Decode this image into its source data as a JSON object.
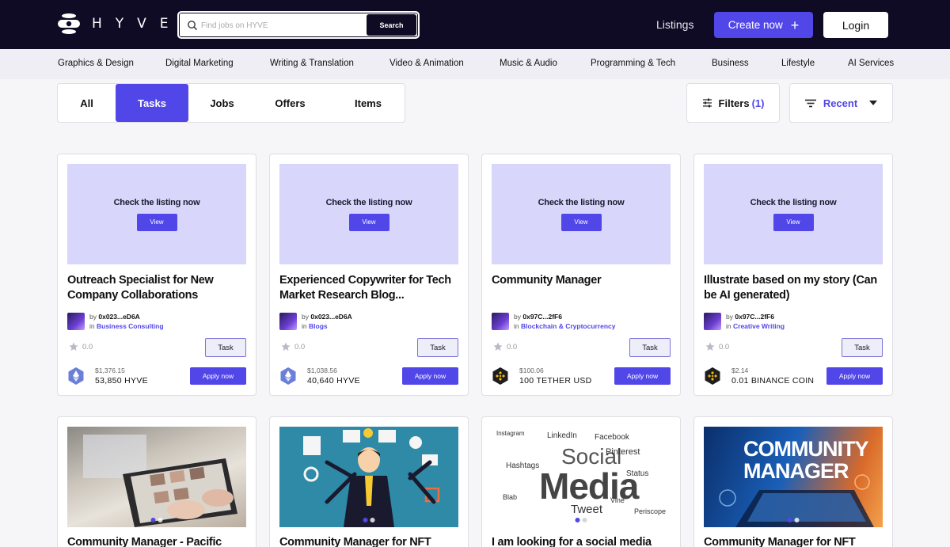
{
  "brand": {
    "name": "HYVE"
  },
  "search": {
    "placeholder": "Find jobs on HYVE",
    "button_label": "Search"
  },
  "nav": {
    "listings": "Listings",
    "create_label": "Create now",
    "create_icon": "plus-icon",
    "login": "Login"
  },
  "categories": [
    "Graphics & Design",
    "Digital Marketing",
    "Writing & Translation",
    "Video & Animation",
    "Music & Audio",
    "Programming & Tech",
    "Business",
    "Lifestyle",
    "AI Services"
  ],
  "tabs": [
    {
      "label": "All",
      "active": false
    },
    {
      "label": "Tasks",
      "active": true
    },
    {
      "label": "Jobs",
      "active": false
    },
    {
      "label": "Offers",
      "active": false
    },
    {
      "label": "Items",
      "active": false
    }
  ],
  "filters": {
    "label": "Filters",
    "count": "(1)"
  },
  "sort": {
    "label": "Recent"
  },
  "colors": {
    "accent": "#5146e8",
    "header_bg": "#0f0b24",
    "thumb_bg": "#d8d6fb"
  },
  "cards": [
    {
      "thumb_title": "Check the listing now",
      "view_label": "View",
      "title": "Outreach Specialist for New Company Collaborations",
      "by_prefix": "by",
      "author": "0x023...eD6A",
      "in_prefix": "in",
      "category": "Business Consulting",
      "rating": "0.0",
      "type": "Task",
      "price_usd": "$1,376.15",
      "price_amount": "53,850 HYVE",
      "coin_icon": "ethereum-icon",
      "apply_label": "Apply now"
    },
    {
      "thumb_title": "Check the listing now",
      "view_label": "View",
      "title": "Experienced Copywriter for Tech Market Research Blog...",
      "by_prefix": "by",
      "author": "0x023...eD6A",
      "in_prefix": "in",
      "category": "Blogs",
      "rating": "0.0",
      "type": "Task",
      "price_usd": "$1,038.56",
      "price_amount": "40,640 HYVE",
      "coin_icon": "ethereum-icon",
      "apply_label": "Apply now"
    },
    {
      "thumb_title": "Check the listing now",
      "view_label": "View",
      "title": "Community Manager",
      "by_prefix": "by",
      "author": "0x97C...2fF6",
      "in_prefix": "in",
      "category": "Blockchain & Cryptocurrency",
      "rating": "0.0",
      "type": "Task",
      "price_usd": "$100.06",
      "price_amount": "100 TETHER USD",
      "coin_icon": "binance-icon",
      "apply_label": "Apply now"
    },
    {
      "thumb_title": "Check the listing now",
      "view_label": "View",
      "title": "Illustrate based on my story (Can be AI generated)",
      "by_prefix": "by",
      "author": "0x97C...2fF6",
      "in_prefix": "in",
      "category": "Creative Writing",
      "rating": "0.0",
      "type": "Task",
      "price_usd": "$2.14",
      "price_amount": "0.01 BINANCE COIN",
      "coin_icon": "binance-icon",
      "apply_label": "Apply now"
    }
  ],
  "cards_row2": [
    {
      "title": "Community Manager - Pacific",
      "image": "tablet-photo"
    },
    {
      "title": "Community Manager for NFT",
      "image": "multitasking-illustration"
    },
    {
      "title": "I am looking for a social media",
      "image": "social-media-word-cloud",
      "word_cloud": [
        "Social",
        "Media",
        "Tweet",
        "Facebook",
        "LinkedIn",
        "Pinterest",
        "Instagram",
        "Hashtags",
        "Blab",
        "Vine",
        "Status",
        "Periscope"
      ]
    },
    {
      "title": "Community Manager for NFT",
      "image": "community-manager-banner",
      "banner_text": [
        "COMMUNITY",
        "MANAGER"
      ]
    }
  ]
}
